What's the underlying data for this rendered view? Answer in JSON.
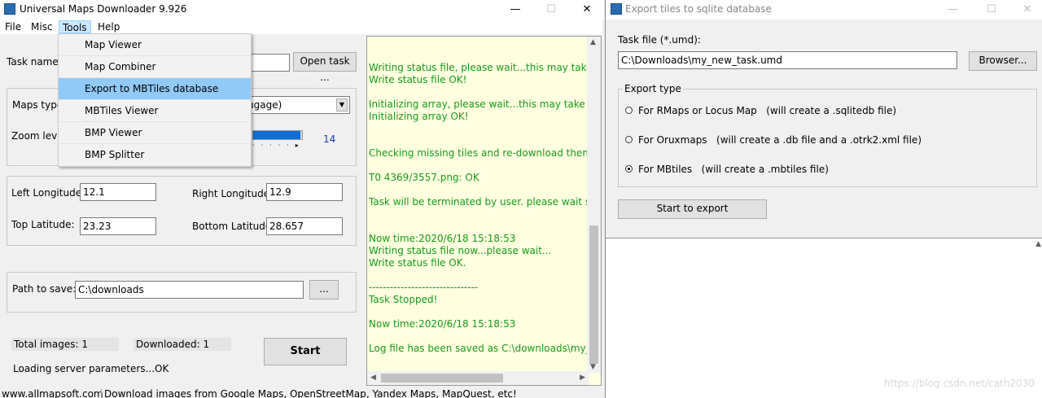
{
  "main_window": {
    "title": "Universal Maps Downloader 9.926",
    "menu": [
      "File",
      "Misc",
      "Tools",
      "Help"
    ],
    "tools_menu": [
      "Map Viewer",
      "Map Combiner",
      "Export to MBTiles database",
      "MBTiles Viewer",
      "BMP Viewer",
      "BMP Splitter"
    ],
    "task_name_label": "Task name:",
    "open_task_button": "Open task ...",
    "maps_type_label": "Maps type",
    "maps_type_value": "ugage)",
    "zoom_level_label": "Zoom leve",
    "zoom_value": "14",
    "left_longitude_label": "Left Longitude:",
    "left_longitude_value": "12.1",
    "right_longitude_label": "Right Longitude:",
    "right_longitude_value": "12.9",
    "top_latitude_label": "Top Latitude:",
    "top_latitude_value": "23.23",
    "bottom_latitude_label": "Bottom Latitude:",
    "bottom_latitude_value": "28.657",
    "path_label": "Path to save:",
    "path_value": "C:\\downloads",
    "browse_button": "...",
    "total_images": "Total images: 1",
    "downloaded": "Downloaded: 1",
    "start_button": "Start",
    "loading_status": "Loading server parameters...OK",
    "log_lines": [
      "Writing status file, please wait...this may take som",
      "Write status file OK!",
      "",
      "Initializing array, please wait...this may take some",
      "Initializing array OK!",
      "",
      "",
      "Checking missing tiles and re-download them, ple",
      "",
      "T0 4369/3557.png: OK",
      "",
      "Task will be terminated by user. please wait some",
      "",
      "",
      "Now time:2020/6/18 15:18:53",
      "Writing status file now...please wait...",
      "Write status file OK.",
      "",
      "-------------------------------",
      "Task Stopped!",
      "",
      "Now time:2020/6/18 15:18:53",
      "",
      "Log file has been saved as C:\\downloads\\my_new"
    ],
    "status_bar_left": "www.allmapsoft.com",
    "status_bar_right": "Download images from Google Maps, OpenStreetMap, Yandex Maps, MapQuest, etc!"
  },
  "export_window": {
    "title": "Export tiles to sqlite database",
    "task_file_label": "Task file (*.umd):",
    "task_file_value": "C:\\Downloads\\my_new_task.umd",
    "browser_button": "Browser...",
    "export_type_label": "Export type",
    "options": [
      {
        "label": "For RMaps or Locus Map   (will create a .sqlitedb file)",
        "selected": false
      },
      {
        "label": "For Oruxmaps   (will create a .db file and a .otrk2.xml file)",
        "selected": false
      },
      {
        "label": "For MBtiles   (will create a .mbtiles file)",
        "selected": true
      }
    ],
    "start_export_button": "Start to export",
    "watermark": "https://blog.csdn.net/cath2030"
  },
  "colors": {
    "log_bg": "#ffffe1",
    "log_text": "#1a9a1a",
    "menu_highlight": "#91c9f7",
    "progress": "#0a6fd8"
  }
}
